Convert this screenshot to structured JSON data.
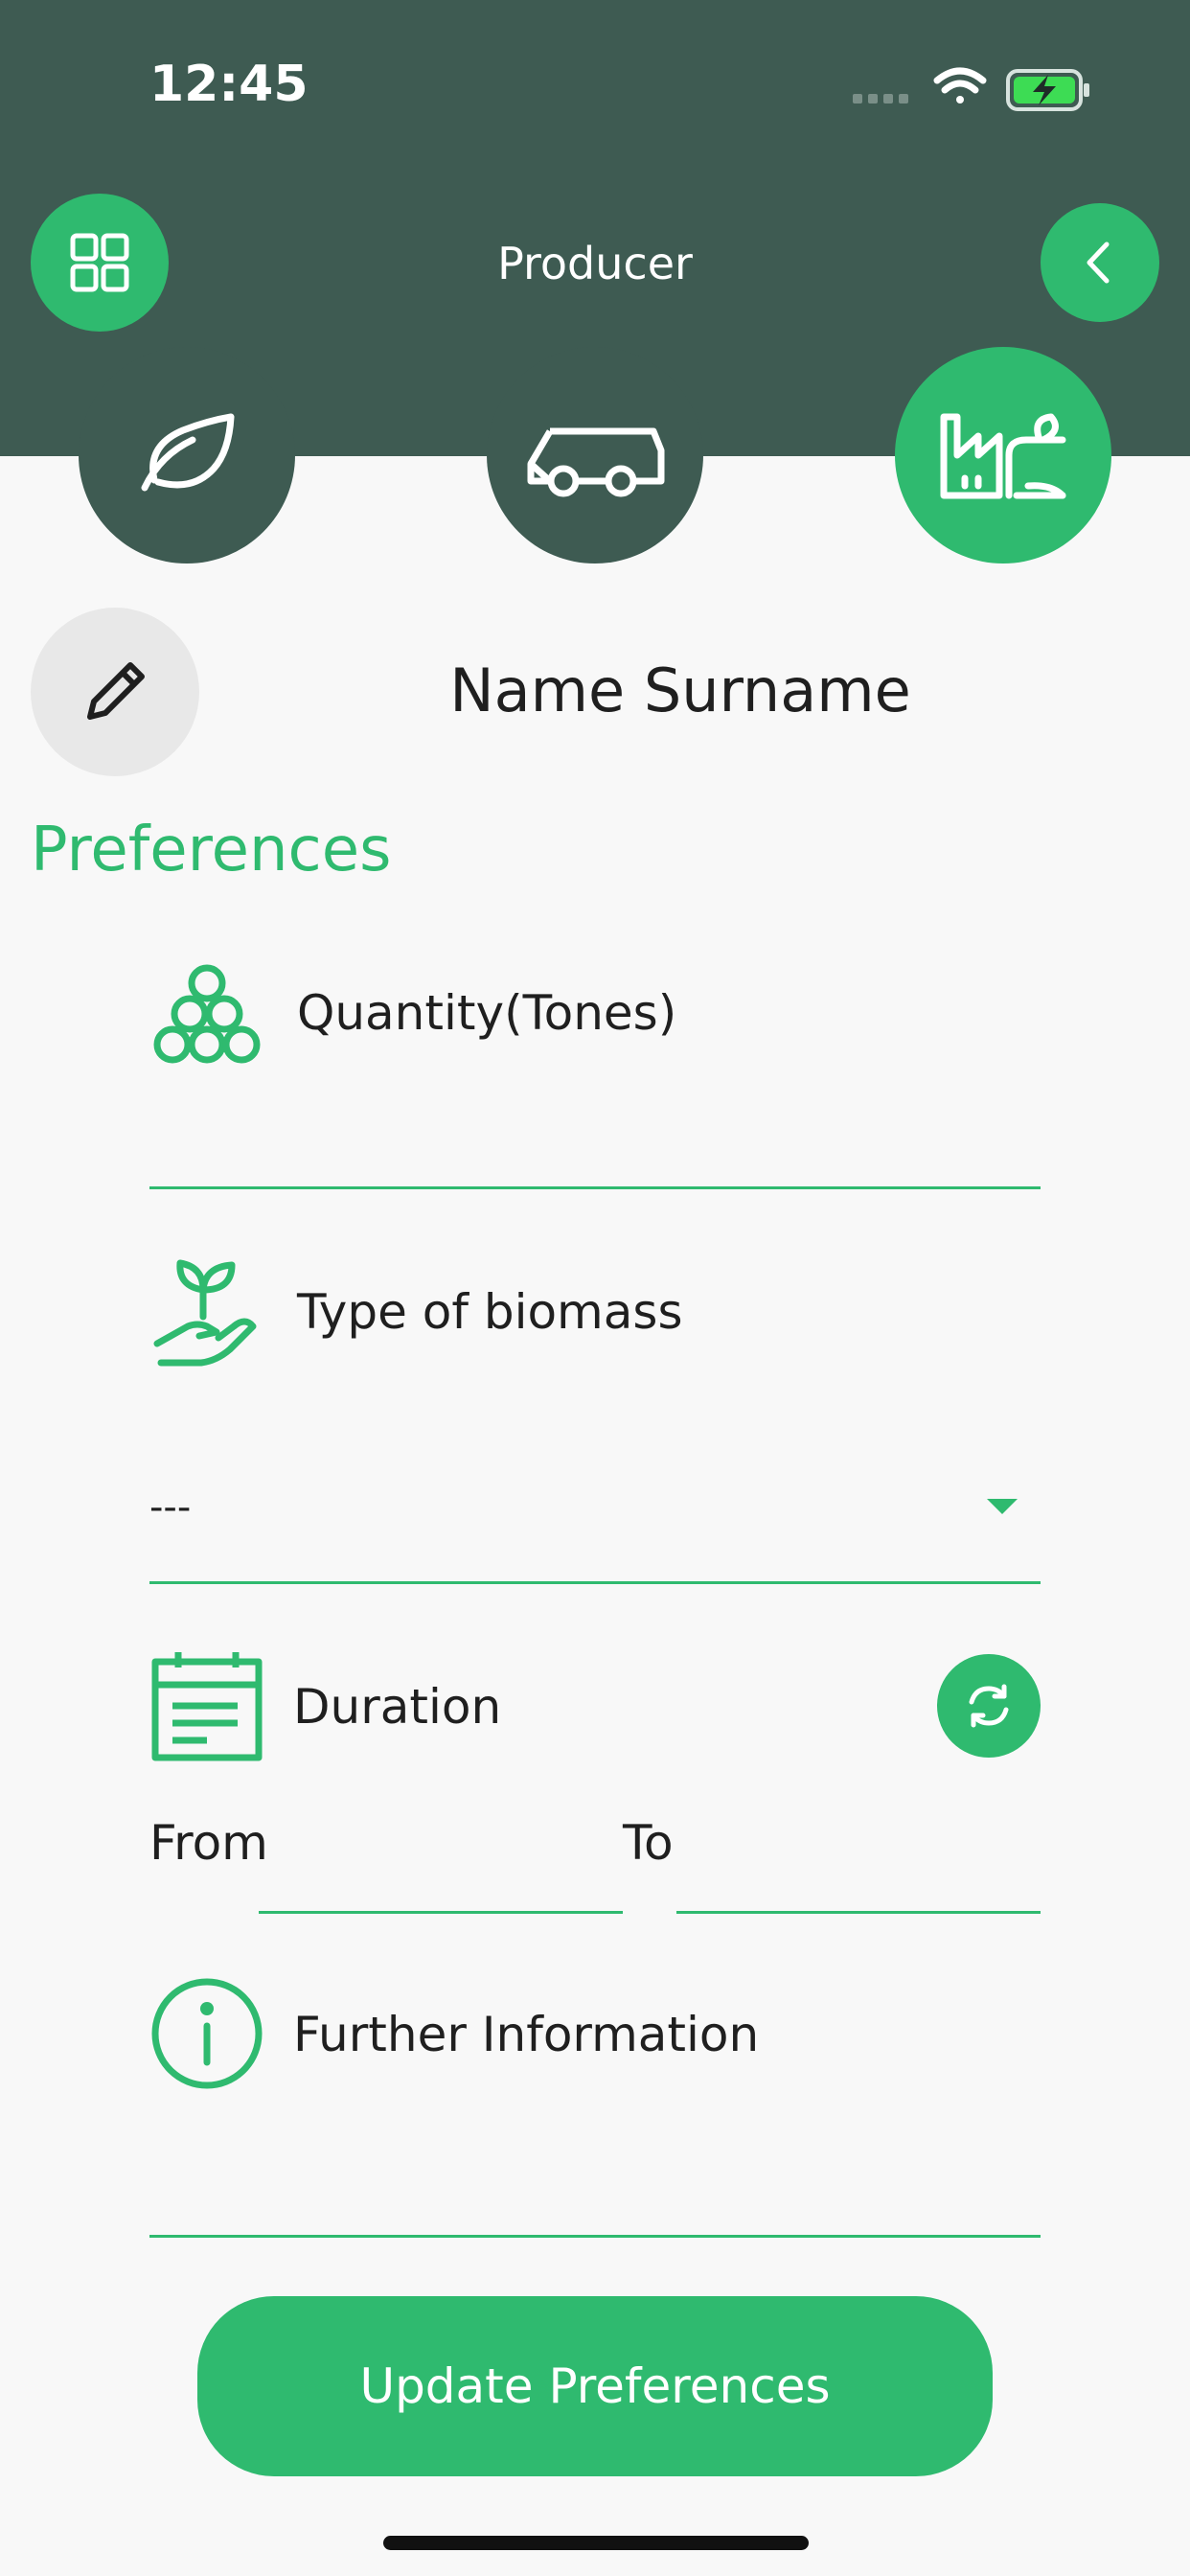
{
  "status_bar": {
    "time": "12:45"
  },
  "header": {
    "title": "Producer"
  },
  "roles": [
    {
      "name": "leaf",
      "active": false
    },
    {
      "name": "truck",
      "active": false
    },
    {
      "name": "factory",
      "active": true
    }
  ],
  "profile": {
    "name": "Name Surname"
  },
  "section_title": "Preferences",
  "form": {
    "quantity_label": "Quantity(Tones)",
    "quantity_value": "",
    "biomass_label": "Type of biomass",
    "biomass_selected": "---",
    "duration_label": "Duration",
    "from_label": "From",
    "to_label": "To",
    "from_value": "",
    "to_value": "",
    "info_label": "Further Information",
    "info_value": ""
  },
  "update_button_label": "Update Preferences",
  "colors": {
    "header": "#3e5b52",
    "accent": "#2fba6f",
    "background": "#f8f8f8"
  }
}
